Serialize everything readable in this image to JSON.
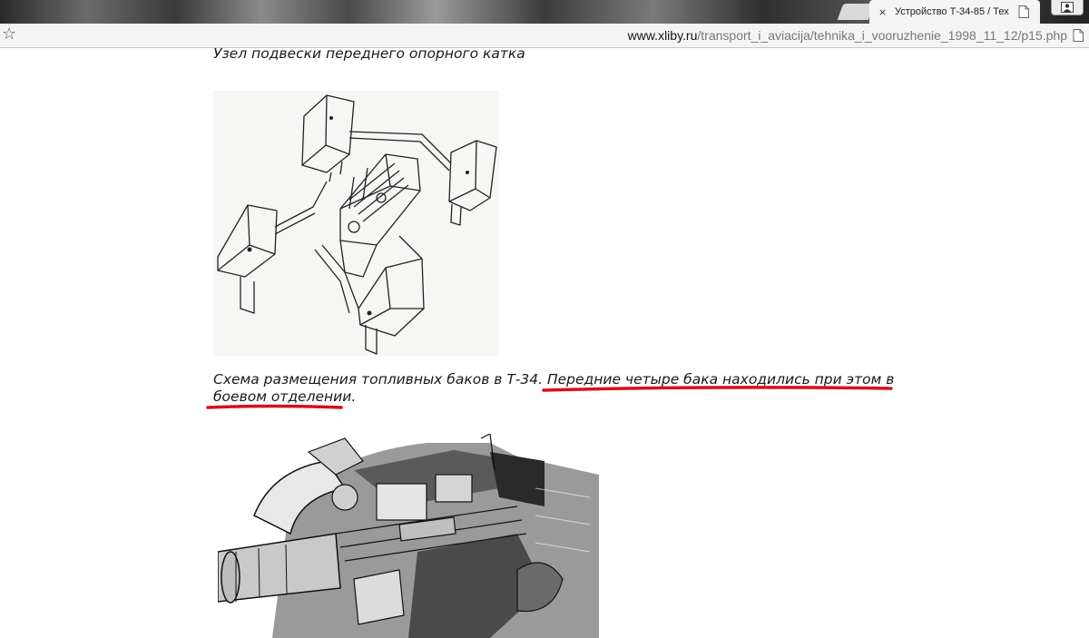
{
  "browser": {
    "tab": {
      "title": "Устройство Т-34-85 / Тех",
      "close_glyph": "×"
    },
    "address": {
      "host": "www.xliby.ru",
      "path": "/transport_i_aviacija/tehnika_i_vooruzhenie_1998_11_12/p15.php"
    },
    "icons": {
      "bookmark": "star-icon",
      "page": "page-icon",
      "profile": "user-icon"
    }
  },
  "page": {
    "caption_top": "Узел подвески переднего опорного катка",
    "caption_fuel": {
      "part1": "Схема размещения топливных баков в Т-34. ",
      "part2": "Передние четыре бака находились при этом в боевом отделении",
      "part3": "."
    },
    "annotation_color": "#d7101c"
  }
}
